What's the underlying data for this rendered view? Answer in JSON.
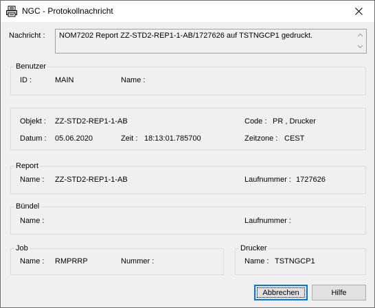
{
  "window": {
    "title": "NGC - Protokollnachricht",
    "icon": "printer-document-icon",
    "close_icon": "close-icon"
  },
  "nachricht": {
    "label": "Nachricht :",
    "text": "NOM7202 Report ZZ-STD2-REP1-1-AB/1727626 auf TSTNGCP1 gedruckt."
  },
  "benutzer": {
    "title": "Benutzer",
    "id_label": "ID :",
    "id_value": "MAIN",
    "name_label": "Name :",
    "name_value": ""
  },
  "objekt": {
    "objekt_label": "Objekt :",
    "objekt_value": "ZZ-STD2-REP1-1-AB",
    "code_label": "Code :",
    "code_value": "PR , Drucker",
    "datum_label": "Datum :",
    "datum_value": "05.06.2020",
    "zeit_label": "Zeit :",
    "zeit_value": "18:13:01.785700",
    "zeitzone_label": "Zeitzone :",
    "zeitzone_value": "CEST"
  },
  "report": {
    "title": "Report",
    "name_label": "Name :",
    "name_value": "ZZ-STD2-REP1-1-AB",
    "laufnummer_label": "Laufnummer :",
    "laufnummer_value": "1727626"
  },
  "buendel": {
    "title": "Bündel",
    "name_label": "Name :",
    "name_value": "",
    "laufnummer_label": "Laufnummer :",
    "laufnummer_value": ""
  },
  "job": {
    "title": "Job",
    "name_label": "Name :",
    "name_value": "RMPRRP",
    "nummer_label": "Nummer :",
    "nummer_value": ""
  },
  "drucker": {
    "title": "Drucker",
    "name_label": "Name :",
    "name_value": "TSTNGCP1"
  },
  "buttons": {
    "abbrechen": "Abbrechen",
    "hilfe": "Hilfe"
  }
}
